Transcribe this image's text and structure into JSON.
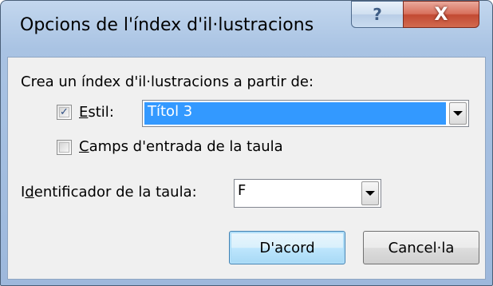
{
  "window": {
    "title": "Opcions de l'índex d'il·lustracions",
    "help_label": "?",
    "close_label": "X"
  },
  "intro_label": "Crea un índex d'il·lustracions a partir de:",
  "style_option": {
    "checked": true,
    "label_accel": "E",
    "label_rest": "stil:",
    "selected_value": "Títol 3"
  },
  "table_entry_fields": {
    "checked": false,
    "label_accel": "C",
    "label_rest": "amps d'entrada de la taula"
  },
  "table_identifier": {
    "label_pre": "I",
    "label_accel": "d",
    "label_rest": "entificador de la taula:",
    "value": "F"
  },
  "buttons": {
    "ok": "D'acord",
    "cancel": "Cancel·la"
  },
  "colors": {
    "selection": "#3399ff",
    "title_bar": "#a9c3e3",
    "close_button": "#c24a33"
  }
}
